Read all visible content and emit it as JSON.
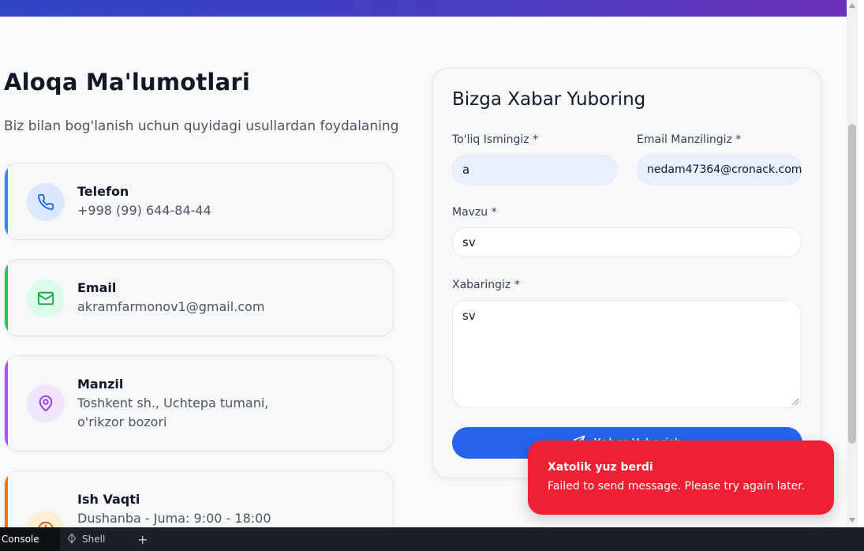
{
  "contact": {
    "heading": "Aloqa Ma'lumotlari",
    "subheading": "Biz bilan bog'lanish uchun quyidagi usullardan foydalaning",
    "items": [
      {
        "title": "Telefon",
        "value": "+998 (99) 644-84-44",
        "icon": "phone-icon",
        "accent": "#3b82f6",
        "icon_bg": "#dbe7fb",
        "icon_color": "#2563eb"
      },
      {
        "title": "Email",
        "value": "akramfarmonov1@gmail.com",
        "icon": "mail-icon",
        "accent": "#22c55e",
        "icon_bg": "#dcfce7",
        "icon_color": "#16a34a"
      },
      {
        "title": "Manzil",
        "value_line1": "Toshkent sh., Uchtepa tumani,",
        "value_line2": "o'rikzor bozori",
        "icon": "map-pin-icon",
        "accent": "#a855f7",
        "icon_bg": "#f0e3fc",
        "icon_color": "#9333ea"
      },
      {
        "title": "Ish Vaqti",
        "value": "Dushanba - Juma: 9:00 - 18:00",
        "icon": "clock-icon",
        "accent": "#f97316",
        "icon_bg": "#ffedd5",
        "icon_color": "#ea580c"
      }
    ]
  },
  "form": {
    "title": "Bizga Xabar Yuboring",
    "name_label": "To'liq Ismingiz *",
    "name_value": "a",
    "email_label": "Email Manzilingiz *",
    "email_value": "nedam47364@cronack.com",
    "subject_label": "Mavzu *",
    "subject_value": "sv",
    "message_label": "Xabaringiz *",
    "message_value": "sv",
    "submit_label": "Xabar Yuborish",
    "submit_icon": "send-icon"
  },
  "toast": {
    "title": "Xatolik yuz berdi",
    "message": "Failed to send message. Please try again later."
  },
  "bottom_bar": {
    "tabs": [
      {
        "label": "Console",
        "active": true
      },
      {
        "label": "Shell",
        "icon": "shell-icon",
        "active": false
      }
    ],
    "add_label": "+"
  },
  "colors": {
    "banner_start": "#3146c4",
    "banner_end": "#6b2fb8",
    "primary": "#2563eb",
    "error": "#f02033"
  }
}
